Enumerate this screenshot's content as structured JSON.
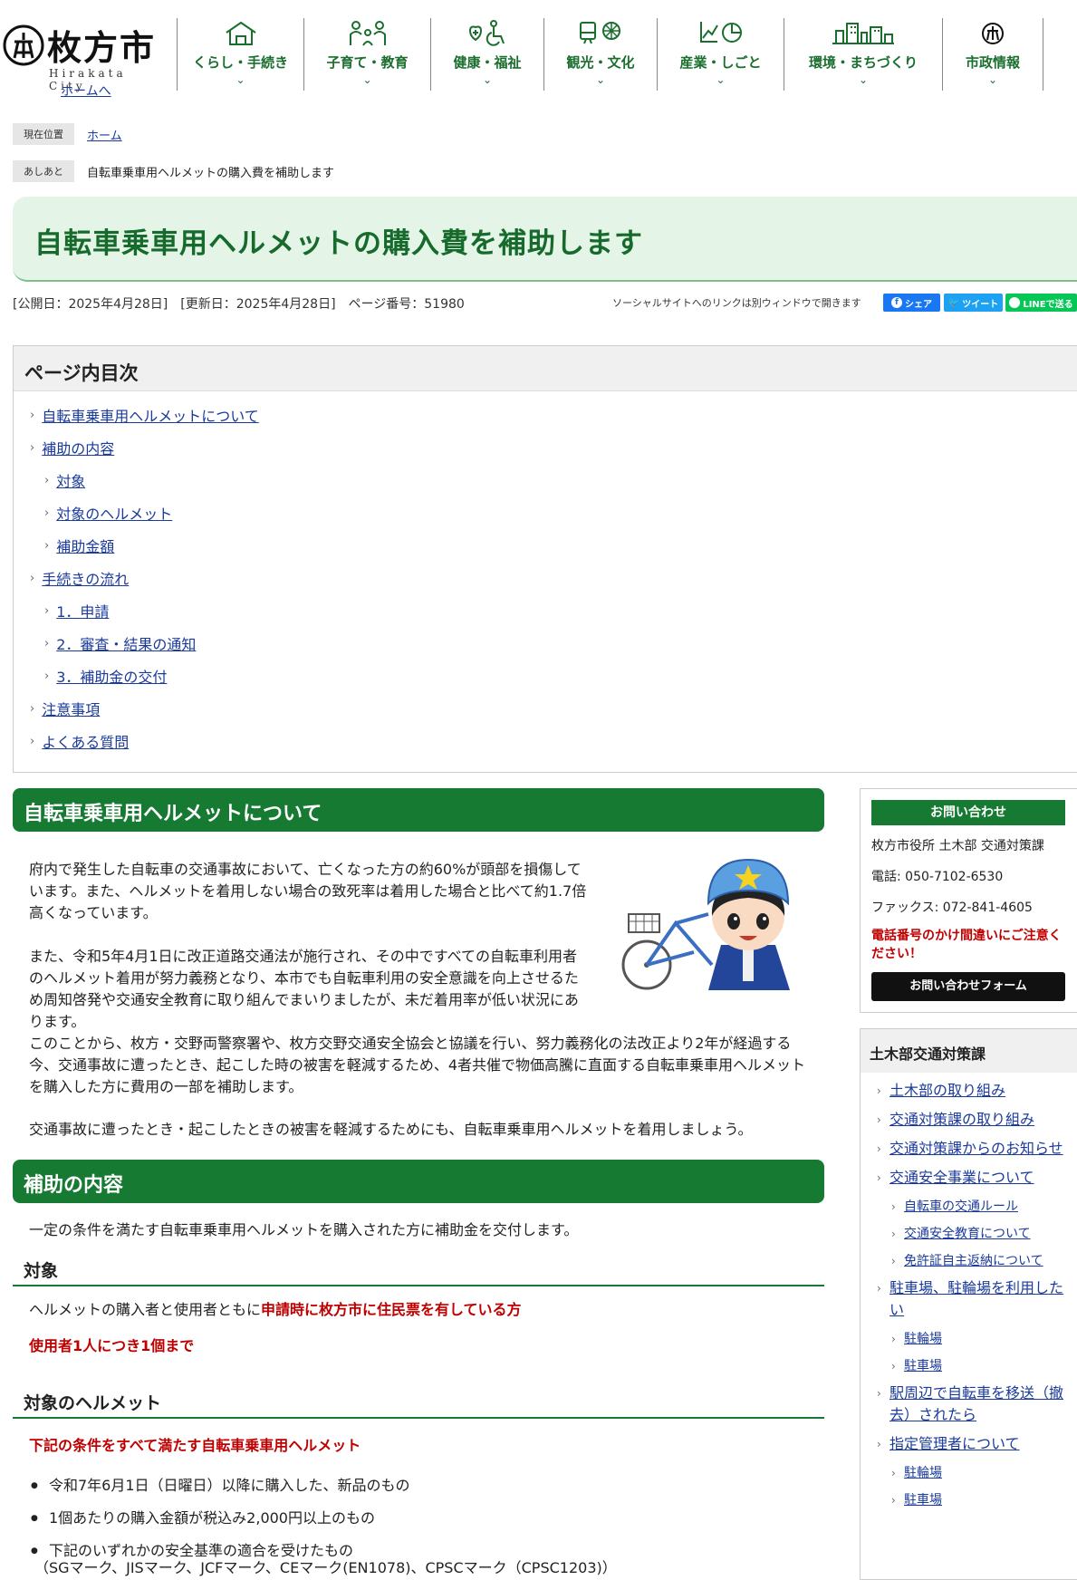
{
  "header": {
    "logo_text": "枚方市",
    "logo_sub": "Hirakata City",
    "home_link": "ホームへ",
    "nav": [
      {
        "label": "くらし・手続き",
        "icon": "house-icon"
      },
      {
        "label": "子育て・教育",
        "icon": "family-icon"
      },
      {
        "label": "健康・福祉",
        "icon": "wheelchair-icon"
      },
      {
        "label": "観光・文化",
        "icon": "tourism-icon"
      },
      {
        "label": "産業・しごと",
        "icon": "chart-icon"
      },
      {
        "label": "環境・まちづくり",
        "icon": "city-icon"
      },
      {
        "label": "市政情報",
        "icon": "cityhall-icon"
      }
    ]
  },
  "breadcrumb": {
    "current_tag": "現在位置",
    "home": "ホーム",
    "trail_tag": "あしあと",
    "trail_item": "自転車乗車用ヘルメットの購入費を補助します"
  },
  "page": {
    "title": "自転車乗車用ヘルメットの購入費を補助します",
    "meta": "[公開日：2025年4月28日]　[更新日：2025年4月28日]　ページ番号：51980",
    "social_note": "ソーシャルサイトへのリンクは別ウィンドウで開きます",
    "share_facebook": "シェア",
    "share_twitter": "ツイート",
    "share_line": "LINEで送る"
  },
  "toc": {
    "heading": "ページ内目次",
    "items": [
      {
        "label": "自転車乗車用ヘルメットについて",
        "level": 1
      },
      {
        "label": "補助の内容",
        "level": 1
      },
      {
        "label": "対象",
        "level": 2
      },
      {
        "label": "対象のヘルメット",
        "level": 2
      },
      {
        "label": "補助金額",
        "level": 2
      },
      {
        "label": "手続きの流れ",
        "level": 1
      },
      {
        "label": "1．申請",
        "level": 2
      },
      {
        "label": "2．審査・結果の通知",
        "level": 2
      },
      {
        "label": "3．補助金の交付",
        "level": 2
      },
      {
        "label": "注意事項",
        "level": 1
      },
      {
        "label": "よくある質問",
        "level": 1
      }
    ]
  },
  "section1": {
    "heading": "自転車乗車用ヘルメットについて",
    "p1": "府内で発生した自転車の交通事故において、亡くなった方の約60%が頭部を損傷しています。また、ヘルメットを着用しない場合の致死率は着用した場合と比べて約1.7倍高くなっています。",
    "p2": "また、令和5年4月1日に改正道路交通法が施行され、その中ですべての自転車利用者のヘルメット着用が努力義務となり、本市でも自転車利用の安全意識を向上させるため周知啓発や交通安全教育に取り組んでまいりましたが、未だ着用率が低い状況にあります。",
    "p3": "このことから、枚方・交野両警察署や、枚方交野交通安全協会と協議を行い、努力義務化の法改正より2年が経過する今、交通事故に遭ったとき、起こした時の被害を軽減するため、4者共催で物価高騰に直面する自転車乗車用ヘルメットを購入した方に費用の一部を補助します。",
    "p4": "交通事故に遭ったとき・起こしたときの被害を軽減するためにも、自転車乗車用ヘルメットを着用しましょう。"
  },
  "section2": {
    "heading": "補助の内容",
    "intro": "一定の条件を満たす自転車乗車用ヘルメットを購入された方に補助金を交付します。",
    "target_heading": "対象",
    "target_text_a": "ヘルメットの購入者と使用者ともに",
    "target_text_b": "申請時に枚方市に住民票を有している方",
    "target_limit": "使用者1人につき1個まで",
    "helmet_heading": "対象のヘルメット",
    "helmet_cond": "下記の条件をすべて満たす自転車乗車用ヘルメット",
    "helmet_items": [
      "令和7年6月1日（日曜日）以降に購入した、新品のもの",
      "1個あたりの購入金額が税込み2,000円以上のもの",
      "下記のいずれかの安全基準の適合を受けたもの"
    ],
    "helmet_marks": "（SGマーク、JISマーク、JCFマーク、CEマーク(EN1078)、CPSCマーク（CPSC1203)）"
  },
  "contact": {
    "heading": "お問い合わせ",
    "dept": "枚方市役所 土木部 交通対策課",
    "tel": "電話: 050-7102-6530",
    "fax": "ファックス: 072-841-4605",
    "warn": "電話番号のかけ間違いにご注意ください！",
    "form": "お問い合わせフォーム"
  },
  "sidebar": {
    "heading": "土木部交通対策課",
    "items": [
      {
        "label": "土木部の取り組み",
        "level": 1
      },
      {
        "label": "交通対策課の取り組み",
        "level": 1
      },
      {
        "label": "交通対策課からのお知らせ",
        "level": 1
      },
      {
        "label": "交通安全事業について",
        "level": 1
      },
      {
        "label": "自転車の交通ルール",
        "level": 2
      },
      {
        "label": "交通安全教育について",
        "level": 2
      },
      {
        "label": "免許証自主返納について",
        "level": 2
      },
      {
        "label": "駐車場、駐輪場を利用したい",
        "level": 1
      },
      {
        "label": "駐輪場",
        "level": 2
      },
      {
        "label": "駐車場",
        "level": 2
      },
      {
        "label": "駅周辺で自転車を移送（撤去）されたら",
        "level": 1
      },
      {
        "label": "指定管理者について",
        "level": 1
      },
      {
        "label": "駐輪場",
        "level": 2
      },
      {
        "label": "駐車場",
        "level": 2
      }
    ]
  },
  "colors": {
    "brand_green": "#167a33",
    "title_bg": "#e4f4e6",
    "alert_red": "#c00000",
    "link_blue": "#1a3a9c"
  }
}
